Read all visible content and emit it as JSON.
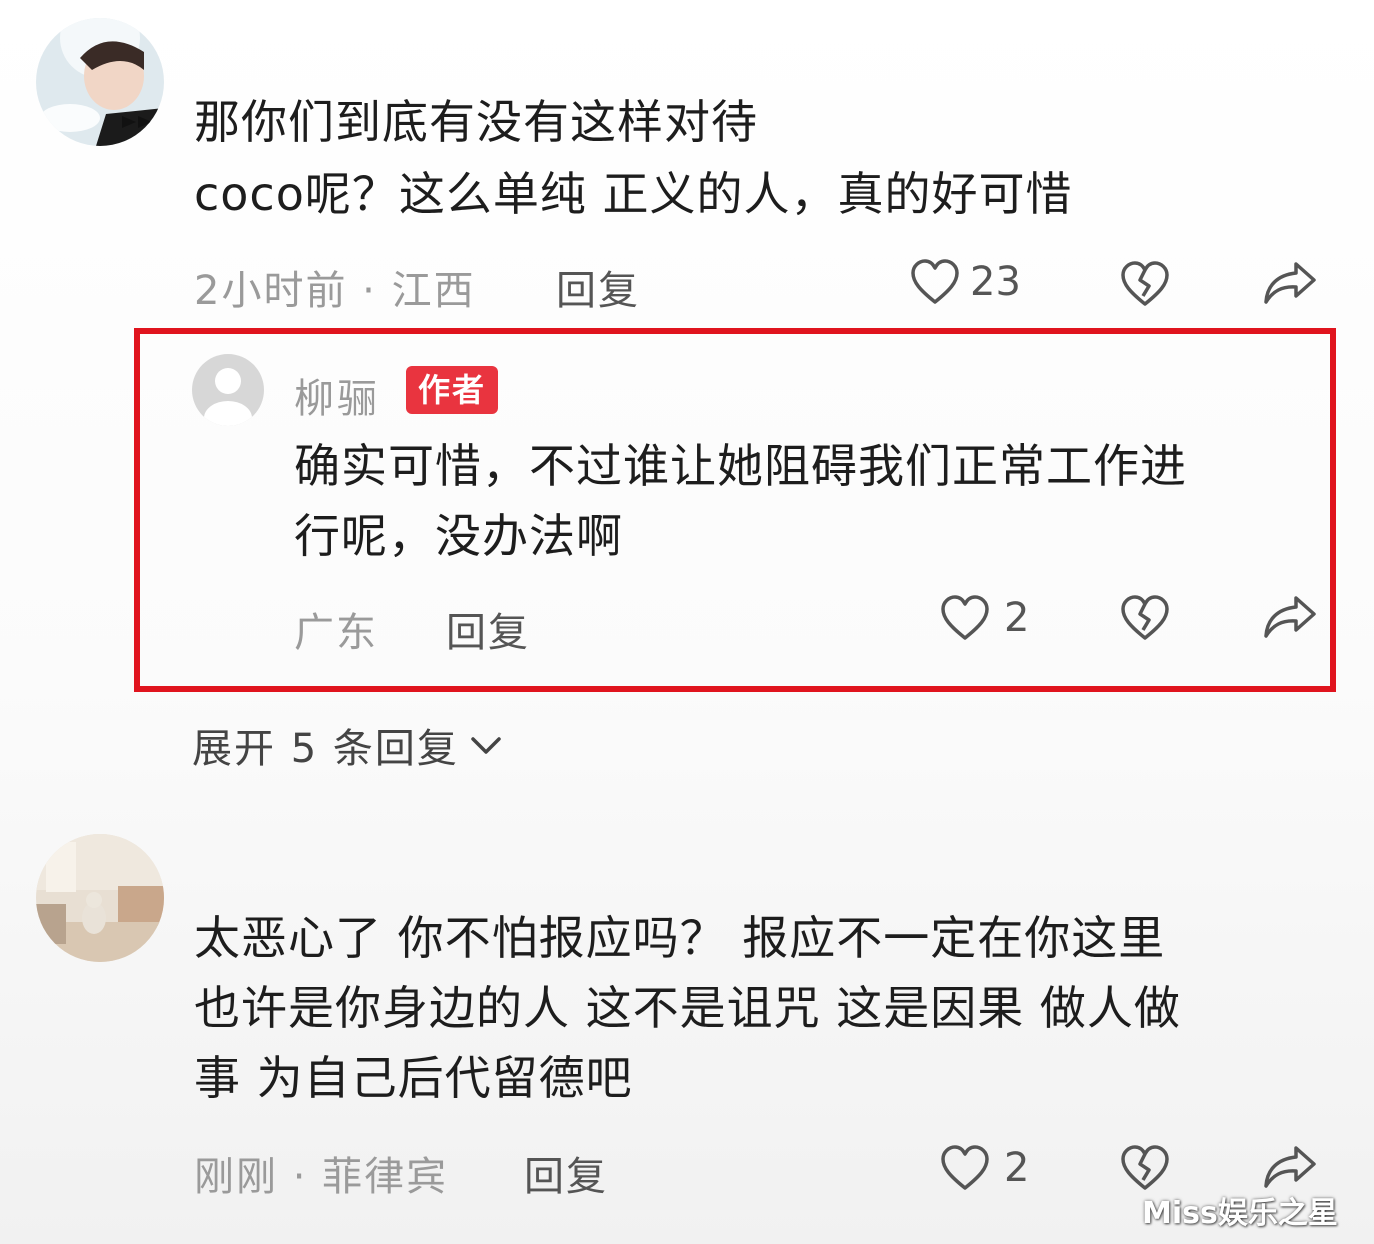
{
  "colors": {
    "highlight": "#e0141e",
    "badge": "#e9343f",
    "meta": "#9a9a9a"
  },
  "comment1": {
    "text_line1": "那你们到底有没有这样对待",
    "text_line2": "coco呢？这么单纯 正义的人，真的好可惜",
    "meta": "2小时前 · 江西",
    "reply_label": "回复",
    "like_count": "23"
  },
  "reply1": {
    "author": "柳骊",
    "badge": "作者",
    "text_line1": "确实可惜，不过谁让她阻碍我们正常工作进",
    "text_line2": "行呢，没办法啊",
    "meta": "广东",
    "reply_label": "回复",
    "like_count": "2"
  },
  "expand_label": "展开 5 条回复",
  "comment2": {
    "text_line1": "太恶心了 你不怕报应吗？ 报应不一定在你这里",
    "text_line2": "也许是你身边的人 这不是诅咒 这是因果 做人做",
    "text_line3": "事 为自己后代留德吧",
    "meta": "刚刚 · 菲律宾",
    "reply_label": "回复",
    "like_count": "2"
  },
  "watermark": "Miss娱乐之星",
  "icons": [
    "avatar",
    "heart-icon",
    "broken-heart-icon",
    "share-icon",
    "chevron-down-icon"
  ]
}
